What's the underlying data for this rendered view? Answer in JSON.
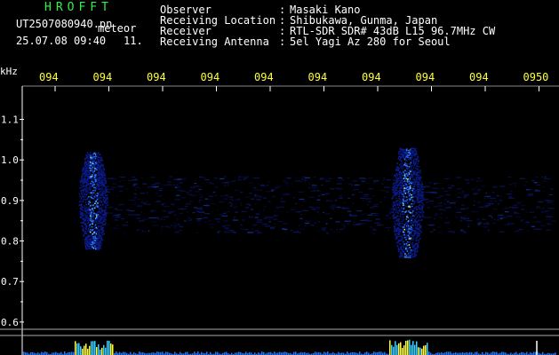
{
  "header": {
    "logo": "HROFFT",
    "filename": "UT2507080940.pn",
    "unit": "meteor",
    "datetime": "25.07.08 09:40",
    "count": "11.",
    "info": [
      {
        "label": "Observer",
        "sep": ":",
        "value": "Masaki Kano"
      },
      {
        "label": "Receiving Location",
        "sep": ":",
        "value": "Shibukawa, Gunma, Japan"
      },
      {
        "label": "Receiver",
        "sep": ":",
        "value": "RTL-SDR SDR# 43dB L15 96.7MHz CW"
      },
      {
        "label": "Receiving Antenna",
        "sep": ":",
        "value": "5el Yagi Az 280 for Seoul"
      }
    ]
  },
  "colors": {
    "background": "#000000",
    "time_tick": "#ffff3a",
    "frame": "#ffffff",
    "logo": "#2ef24a",
    "spectrum_low": "#0a1a8a",
    "spectrum_mid": "#2a7aff",
    "spectrum_high": "#ffff40"
  },
  "chart_data": {
    "type": "heatmap",
    "xlabel": "",
    "ylabel": "kHz",
    "time_ticks": [
      "094",
      "094",
      "094",
      "094",
      "094",
      "094",
      "094",
      "094",
      "094",
      "0950"
    ],
    "freq_ticks": [
      "1.1",
      "1.0",
      "0.9",
      "0.8",
      "0.7",
      "0.6"
    ],
    "ylim": [
      0.58,
      1.18
    ],
    "bursts": [
      {
        "minute_index": 0.7,
        "freq_low": 0.78,
        "freq_high": 1.02,
        "intensity": "strong"
      },
      {
        "minute_index": 6.55,
        "freq_low": 0.76,
        "freq_high": 1.03,
        "intensity": "strong"
      }
    ],
    "background_band": {
      "freq_low": 0.82,
      "freq_high": 0.96
    }
  }
}
